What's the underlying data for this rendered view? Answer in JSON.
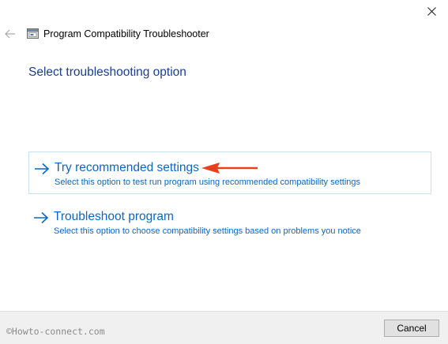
{
  "window": {
    "title": "Program Compatibility Troubleshooter",
    "close_icon": "close-icon",
    "back_icon": "back-arrow-icon",
    "app_icon": "troubleshooter-icon"
  },
  "main": {
    "heading": "Select troubleshooting option",
    "options": [
      {
        "title": "Try recommended settings",
        "description": "Select this option to test run program using recommended compatibility settings",
        "icon": "arrow-right-icon",
        "selected": true
      },
      {
        "title": "Troubleshoot program",
        "description": "Select this option to choose compatibility settings based on problems you notice",
        "icon": "arrow-right-icon",
        "selected": false
      }
    ],
    "annotation_icon": "red-pointer-arrow-icon"
  },
  "footer": {
    "watermark": "©Howto-connect.com",
    "cancel_label": "Cancel"
  },
  "colors": {
    "heading": "#1a3e96",
    "link": "#0b67c6",
    "selection_border": "#c9e1f5",
    "annotation": "#e8401c",
    "footer_bg": "#f0f0f0"
  }
}
